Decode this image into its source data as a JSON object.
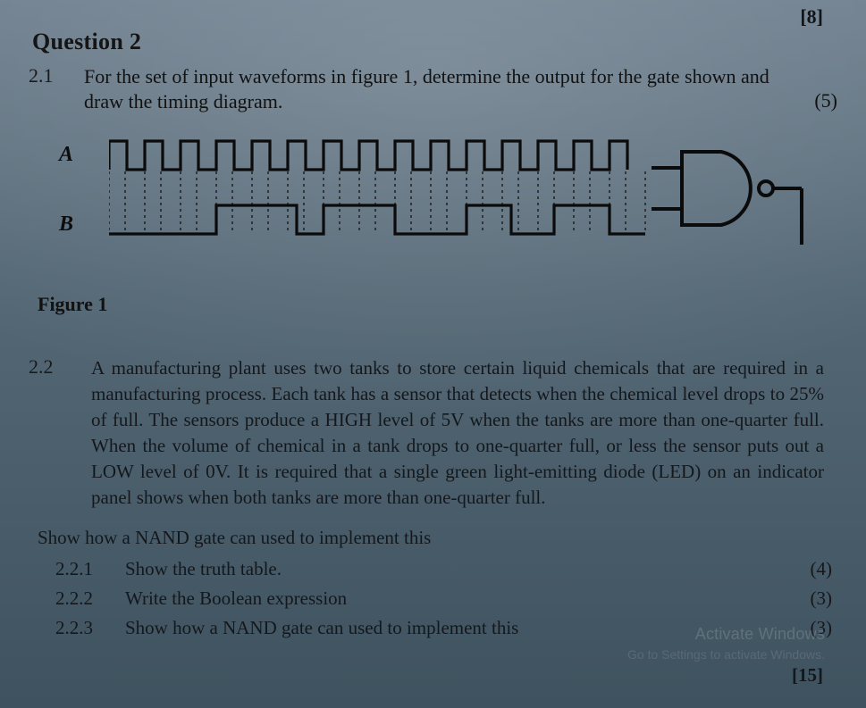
{
  "top_marks": "[8]",
  "title": "Question 2",
  "q21": {
    "num": "2.1",
    "text_a": "For the set of input waveforms in figure 1, determine the output for the gate shown and",
    "text_b": "draw the timing diagram.",
    "marks": "(5)"
  },
  "signals": {
    "A": "A",
    "B": "B"
  },
  "fig_caption": "Figure 1",
  "q22": {
    "num": "2.2",
    "text": "A manufacturing plant uses two tanks to store certain liquid chemicals that are required in a manufacturing process. Each tank has a sensor that detects when the chemical level drops to 25% of full. The sensors produce a HIGH level of 5V when the tanks are more than one-quarter full. When the volume of chemical in a tank drops to one-quarter full, or less the sensor puts out a LOW level of 0V. It is required that a single green light-emitting diode (LED) on an indicator panel shows when both tanks are more than one-quarter full."
  },
  "instruction": "Show how a NAND gate can used to implement this",
  "subs": [
    {
      "n": "2.2.1",
      "t": "Show the truth table.",
      "m": "(4)"
    },
    {
      "n": "2.2.2",
      "t": "Write the Boolean expression",
      "m": "(3)"
    },
    {
      "n": "2.2.3",
      "t": "Show how a NAND gate can used to implement this",
      "m": "(3)"
    }
  ],
  "total": "[15]",
  "watermark1": "Activate Windows",
  "watermark2": "Go to Settings to activate Windows."
}
